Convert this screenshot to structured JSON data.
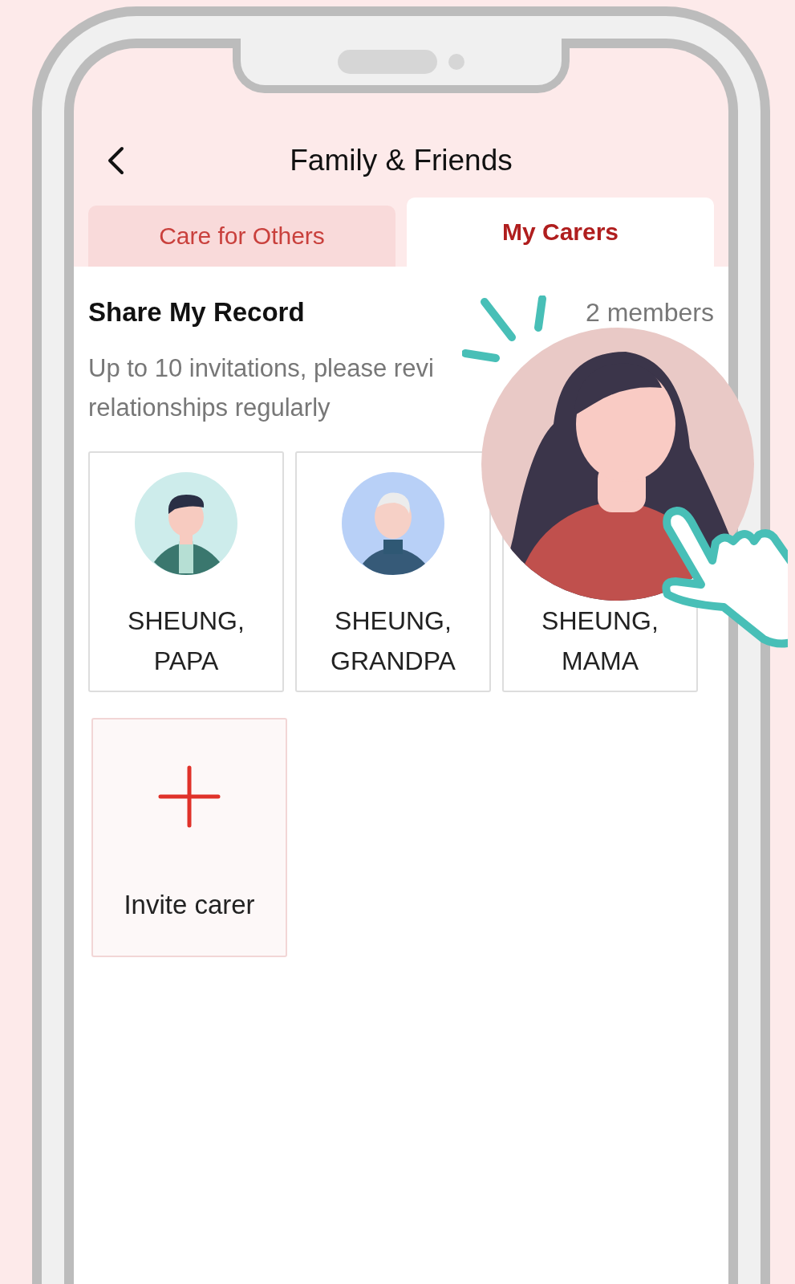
{
  "header": {
    "title": "Family & Friends"
  },
  "tabs": [
    {
      "label": "Care for Others",
      "selected": false
    },
    {
      "label": "My Carers",
      "selected": true
    }
  ],
  "section": {
    "title": "Share My Record",
    "count": "2 members",
    "note_lines": [
      "Up to 10 invitations, please revi",
      "relationships regularly"
    ]
  },
  "carers": [
    {
      "name": "SHEUNG, PAPA",
      "kind": "young_man"
    },
    {
      "name": "SHEUNG, GRANDPA",
      "kind": "old_man"
    },
    {
      "name": "SHEUNG, MAMA"
    }
  ],
  "invite": {
    "label": "Invite carer"
  },
  "magnified_avatar": {
    "kind": "woman"
  }
}
